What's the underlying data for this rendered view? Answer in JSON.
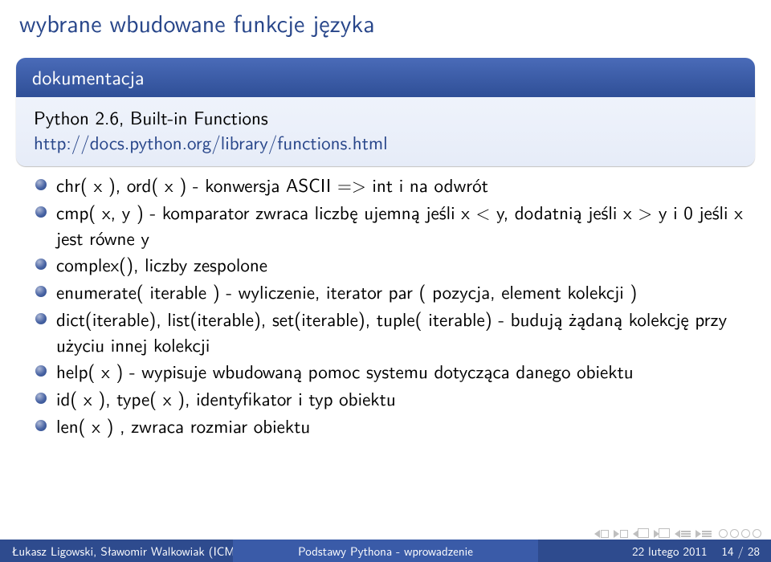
{
  "title": "wybrane wbudowane funkcje języka",
  "block": {
    "title": "dokumentacja",
    "line1": "Python 2.6, Built-in Functions",
    "link": "http://docs.python.org/library/functions.html"
  },
  "items": [
    "chr( x ), ord( x ) - konwersja ASCII => int i na odwrót",
    "cmp( x, y ) - komparator zwraca liczbę ujemną jeśli x < y, dodatnią jeśli x > y i 0 jeśli x jest równe y",
    "complex(), liczby zespolone",
    "enumerate( iterable ) - wyliczenie, iterator par ( pozycja, element kolekcji )",
    "dict(iterable), list(iterable), set(iterable), tuple( iterable) - budują żądaną kolekcję przy użyciu innej kolekcji",
    "help( x ) - wypisuje wbudowaną pomoc systemu dotycząca danego obiektu",
    "id( x ), type( x ), identyfikator i typ obiektu",
    "len( x ) , zwraca rozmiar obiektu"
  ],
  "footer": {
    "left": "Łukasz Ligowski, Sławomir Walkowiak (ICM",
    "center": "Podstawy Pythona - wprowadzenie",
    "date": "22 lutego 2011",
    "page": "14 / 28"
  }
}
